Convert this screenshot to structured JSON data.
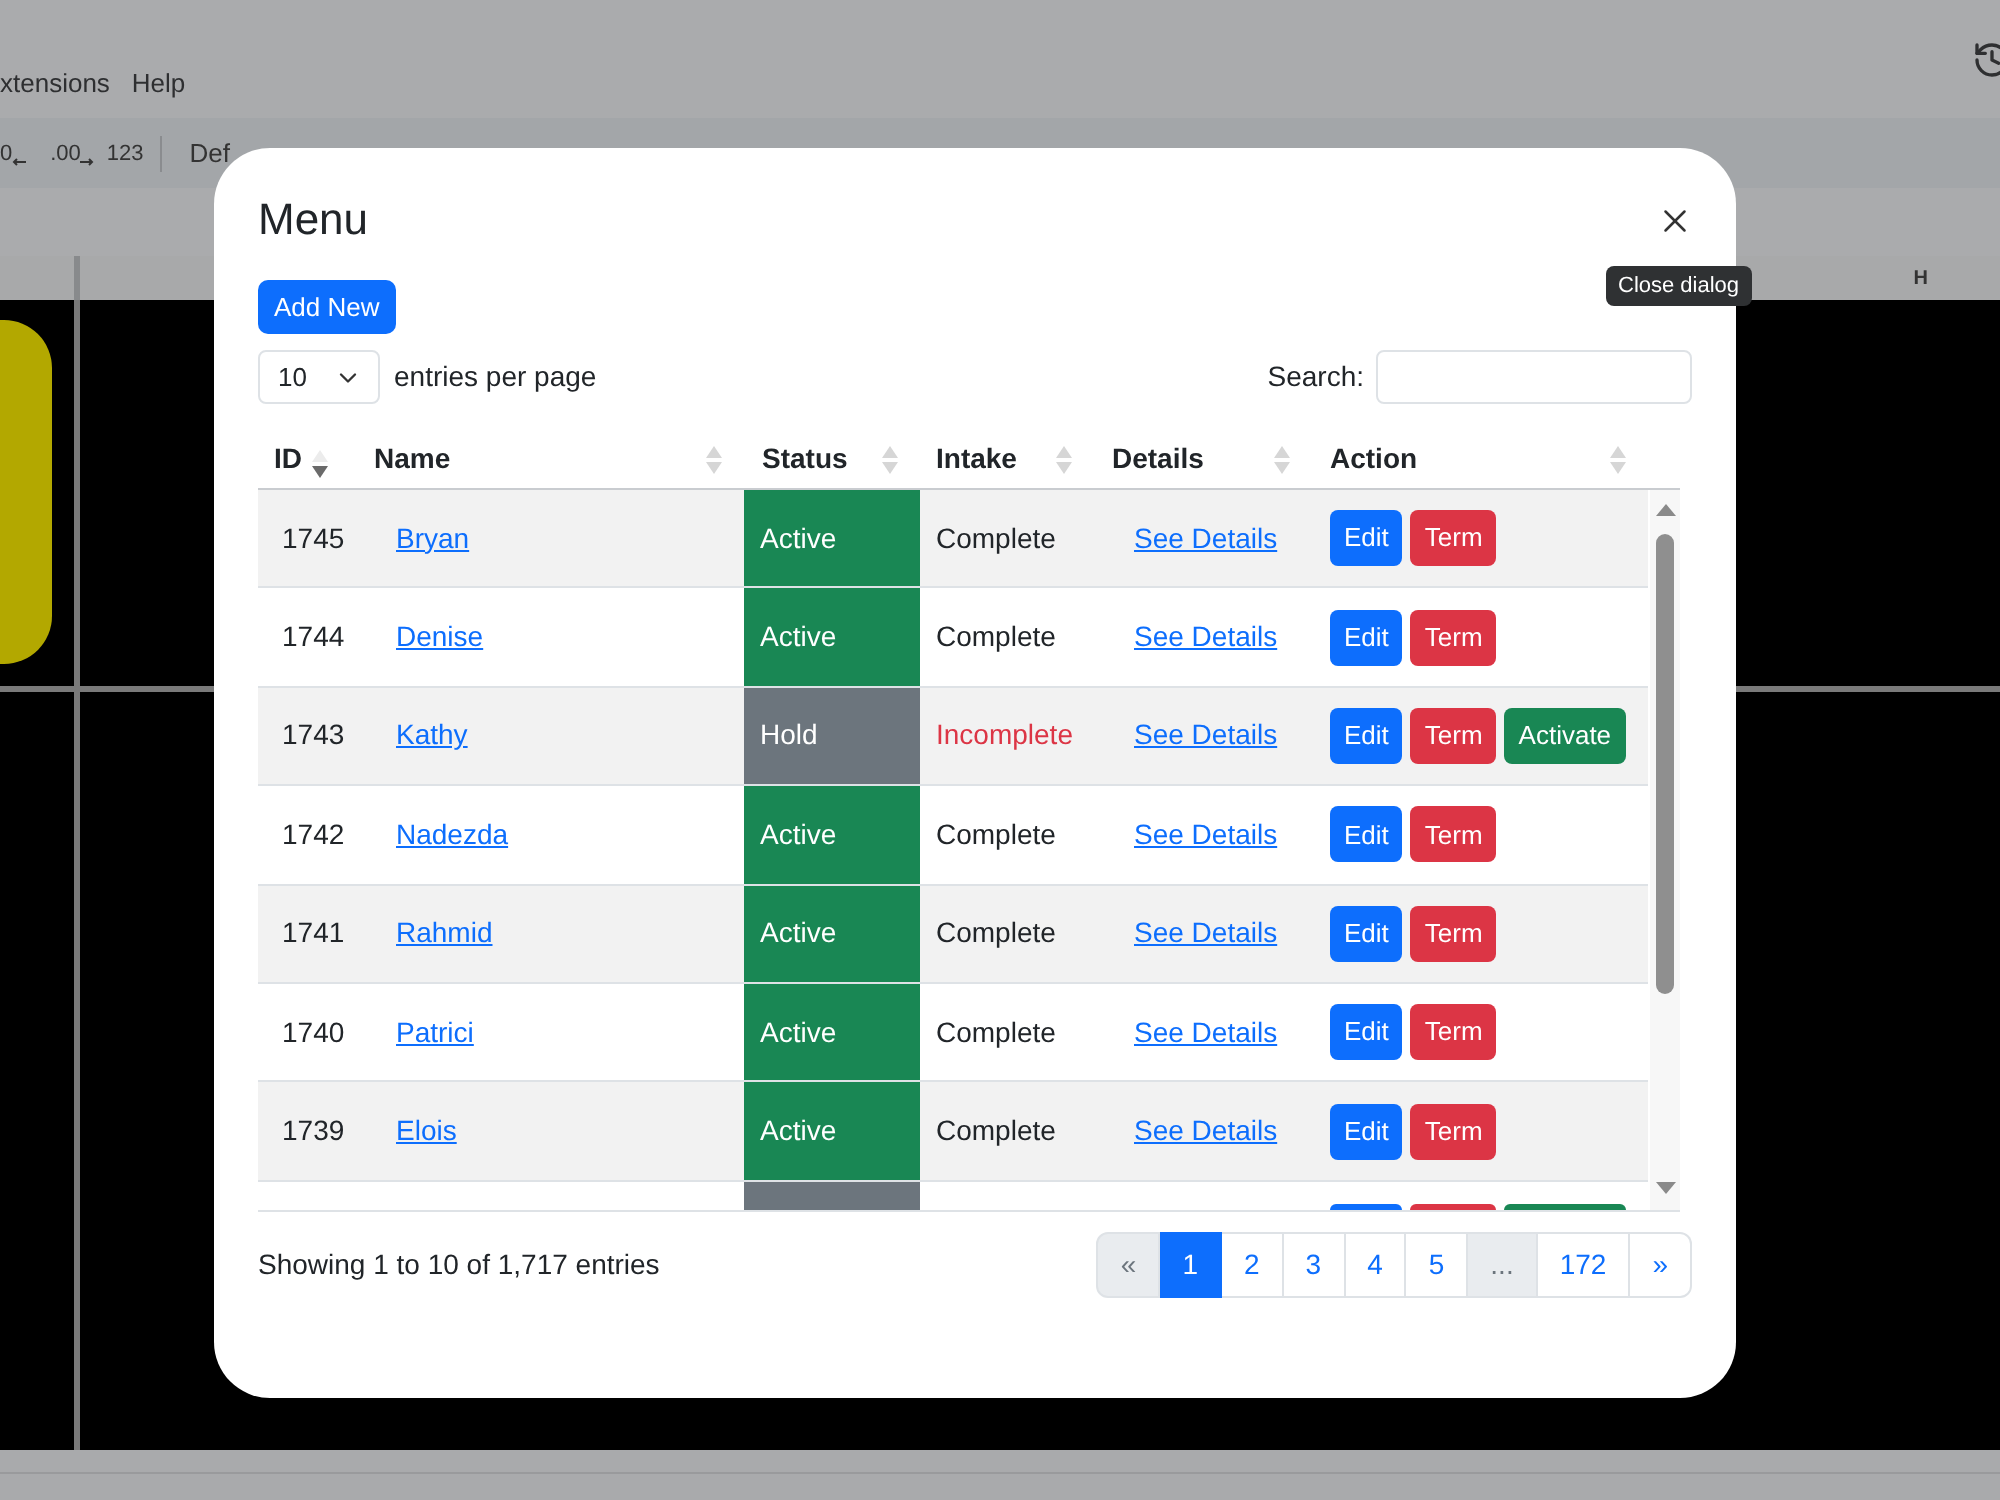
{
  "sheet": {
    "menu": [
      "xtensions",
      "Help"
    ],
    "toolbar": [
      {
        "kind": "decrease_decimal",
        "text": "0"
      },
      {
        "kind": "increase_decimal",
        "text": ".00"
      },
      {
        "kind": "format",
        "text": "123"
      },
      {
        "kind": "separator"
      },
      {
        "kind": "font",
        "text": "Def"
      }
    ],
    "column_header": "H"
  },
  "dialog": {
    "title": "Menu",
    "close_tooltip": "Close dialog",
    "add_button": "Add New",
    "page_size": {
      "value": "10",
      "label": "entries per page"
    },
    "search": {
      "label": "Search:"
    },
    "table": {
      "columns": [
        {
          "label": "ID",
          "sorted": true
        },
        {
          "label": "Name",
          "sorted": false
        },
        {
          "label": "Status",
          "sorted": false
        },
        {
          "label": "Intake",
          "sorted": false
        },
        {
          "label": "Details",
          "sorted": false
        },
        {
          "label": "Action",
          "sorted": false
        }
      ],
      "rows": [
        {
          "id": "1745",
          "name": "Bryan",
          "status": {
            "text": "Active",
            "color": "#198754"
          },
          "intake": "Complete",
          "intake_alert": false,
          "details": "See Details",
          "actions": [
            {
              "label": "Edit",
              "kind": "primary"
            },
            {
              "label": "Term",
              "kind": "danger"
            }
          ]
        },
        {
          "id": "1744",
          "name": "Denise",
          "status": {
            "text": "Active",
            "color": "#198754"
          },
          "intake": "Complete",
          "intake_alert": false,
          "details": "See Details",
          "actions": [
            {
              "label": "Edit",
              "kind": "primary"
            },
            {
              "label": "Term",
              "kind": "danger"
            }
          ]
        },
        {
          "id": "1743",
          "name": "Kathy",
          "status": {
            "text": "Hold",
            "color": "#6c757d"
          },
          "intake": "Incomplete",
          "intake_alert": true,
          "details": "See Details",
          "actions": [
            {
              "label": "Edit",
              "kind": "primary"
            },
            {
              "label": "Term",
              "kind": "danger"
            },
            {
              "label": "Activate",
              "kind": "success"
            }
          ]
        },
        {
          "id": "1742",
          "name": "Nadezda",
          "status": {
            "text": "Active",
            "color": "#198754"
          },
          "intake": "Complete",
          "intake_alert": false,
          "details": "See Details",
          "actions": [
            {
              "label": "Edit",
              "kind": "primary"
            },
            {
              "label": "Term",
              "kind": "danger"
            }
          ]
        },
        {
          "id": "1741",
          "name": "Rahmid",
          "status": {
            "text": "Active",
            "color": "#198754"
          },
          "intake": "Complete",
          "intake_alert": false,
          "details": "See Details",
          "actions": [
            {
              "label": "Edit",
              "kind": "primary"
            },
            {
              "label": "Term",
              "kind": "danger"
            }
          ]
        },
        {
          "id": "1740",
          "name": "Patrici",
          "status": {
            "text": "Active",
            "color": "#198754"
          },
          "intake": "Complete",
          "intake_alert": false,
          "details": "See Details",
          "actions": [
            {
              "label": "Edit",
              "kind": "primary"
            },
            {
              "label": "Term",
              "kind": "danger"
            }
          ]
        },
        {
          "id": "1739",
          "name": "Elois",
          "status": {
            "text": "Active",
            "color": "#198754"
          },
          "intake": "Complete",
          "intake_alert": false,
          "details": "See Details",
          "actions": [
            {
              "label": "Edit",
              "kind": "primary"
            },
            {
              "label": "Term",
              "kind": "danger"
            }
          ]
        }
      ],
      "partial_row": {
        "status": {
          "color": "#6c757d"
        },
        "actions": [
          {
            "kind": "primary"
          },
          {
            "kind": "danger"
          },
          {
            "kind": "success"
          }
        ]
      }
    },
    "footer": {
      "info": "Showing 1 to 10 of 1,717 entries",
      "pages": [
        {
          "label": "«",
          "selected": false,
          "disabled": true
        },
        {
          "label": "1",
          "selected": true,
          "disabled": false
        },
        {
          "label": "2",
          "selected": false,
          "disabled": false
        },
        {
          "label": "3",
          "selected": false,
          "disabled": false
        },
        {
          "label": "4",
          "selected": false,
          "disabled": false
        },
        {
          "label": "5",
          "selected": false,
          "disabled": false
        },
        {
          "label": "...",
          "selected": false,
          "disabled": true
        },
        {
          "label": "172",
          "selected": false,
          "disabled": false
        },
        {
          "label": "»",
          "selected": false,
          "disabled": false
        }
      ]
    }
  }
}
